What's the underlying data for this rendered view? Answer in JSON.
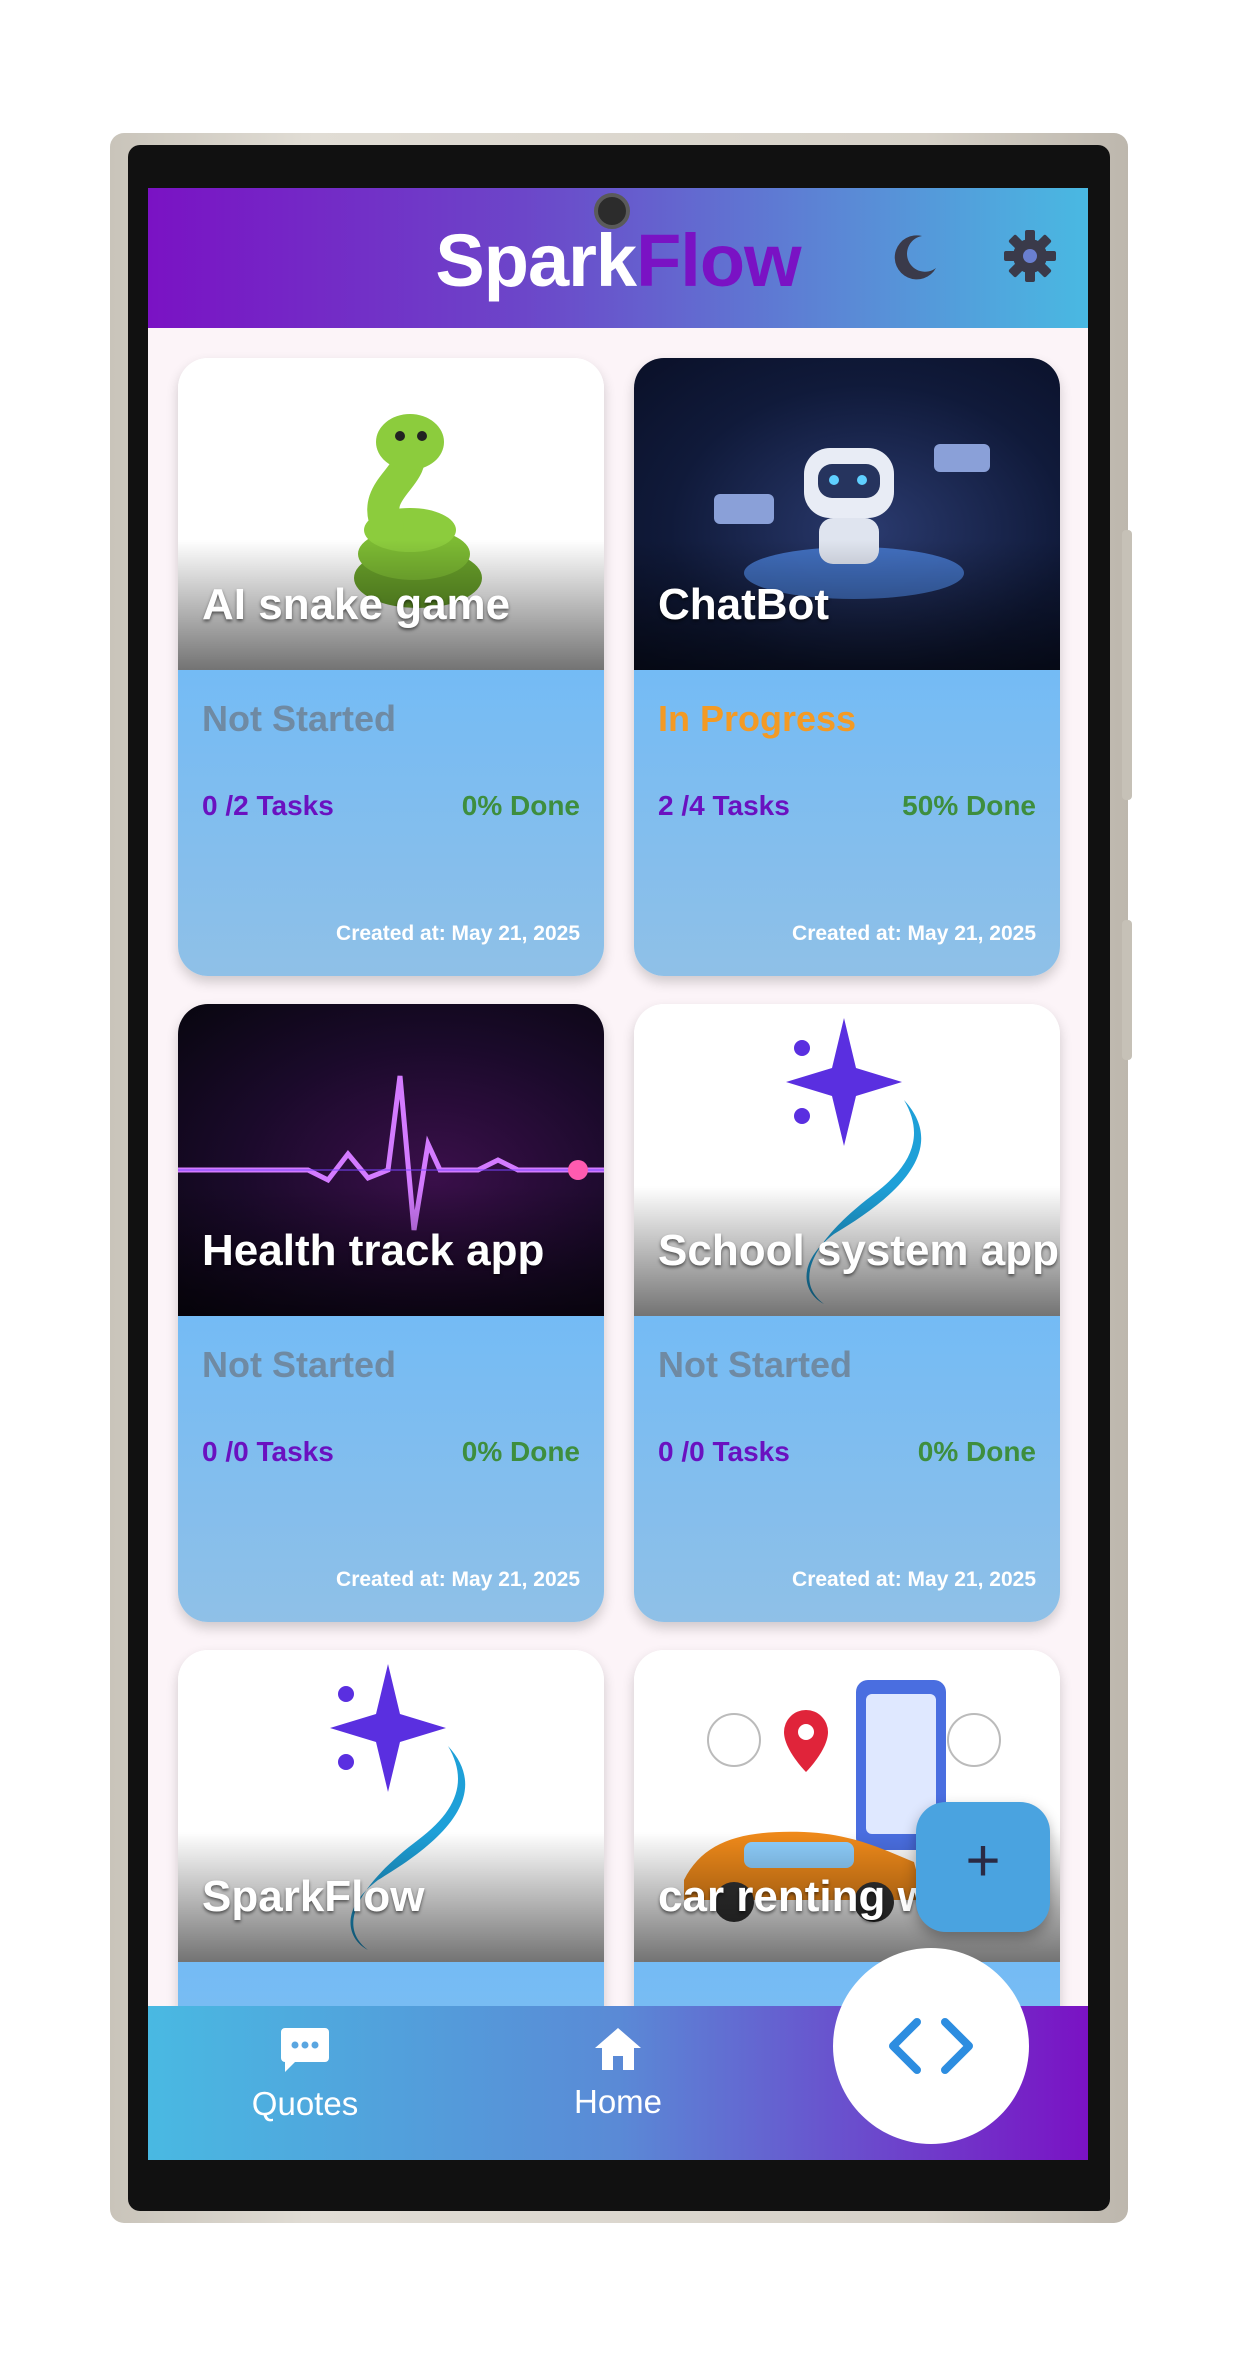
{
  "app": {
    "brand_part1": "Spark",
    "brand_part2": "Flow"
  },
  "colors": {
    "primary_purple": "#7a12c4",
    "accent_blue": "#49b9e2",
    "in_progress": "#f39a24",
    "not_started": "#6f8aa3",
    "done_green": "#3e8e3e"
  },
  "header": {
    "theme_icon": "moon-icon",
    "settings_icon": "gear-icon"
  },
  "projects": [
    {
      "title": "AI snake game",
      "status": "Not Started",
      "tasks": "0 /2 Tasks",
      "done": "0% Done",
      "created": "Created at: May 21, 2025"
    },
    {
      "title": "ChatBot",
      "status": "In Progress",
      "tasks": "2 /4 Tasks",
      "done": "50% Done",
      "created": "Created at: May 21, 2025"
    },
    {
      "title": "Health track app",
      "status": "Not Started",
      "tasks": "0 /0 Tasks",
      "done": "0% Done",
      "created": "Created at: May 21, 2025"
    },
    {
      "title": "School system app",
      "status": "Not Started",
      "tasks": "0 /0 Tasks",
      "done": "0% Done",
      "created": "Created at: May 21, 2025"
    },
    {
      "title": "SparkFlow"
    },
    {
      "title": "car renting w"
    }
  ],
  "fab": {
    "add_label": "+"
  },
  "nav": {
    "items": [
      {
        "label": "Quotes",
        "icon": "chat-bubble-icon"
      },
      {
        "label": "Home",
        "icon": "home-icon"
      }
    ],
    "code_button_label": "< >"
  }
}
